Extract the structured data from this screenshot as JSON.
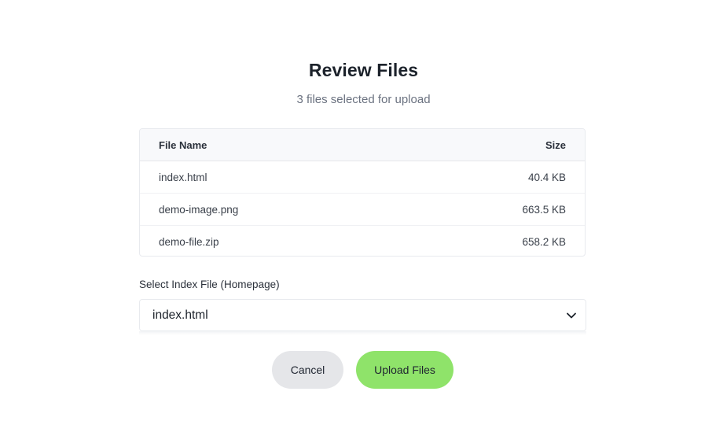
{
  "dialog": {
    "title": "Review Files",
    "subtitle": "3 files selected for upload"
  },
  "table": {
    "headers": {
      "name": "File Name",
      "size": "Size"
    },
    "rows": [
      {
        "name": "index.html",
        "size": "40.4 KB"
      },
      {
        "name": "demo-image.png",
        "size": "663.5 KB"
      },
      {
        "name": "demo-file.zip",
        "size": "658.2 KB"
      }
    ]
  },
  "index_select": {
    "label": "Select Index File (Homepage)",
    "value": "index.html",
    "icon": "chevron-down-icon"
  },
  "actions": {
    "cancel_label": "Cancel",
    "upload_label": "Upload Files"
  },
  "colors": {
    "upload_button": "#8fe36a",
    "cancel_button": "#e5e6e9",
    "title": "#1c222b",
    "subtitle": "#6b7280"
  }
}
